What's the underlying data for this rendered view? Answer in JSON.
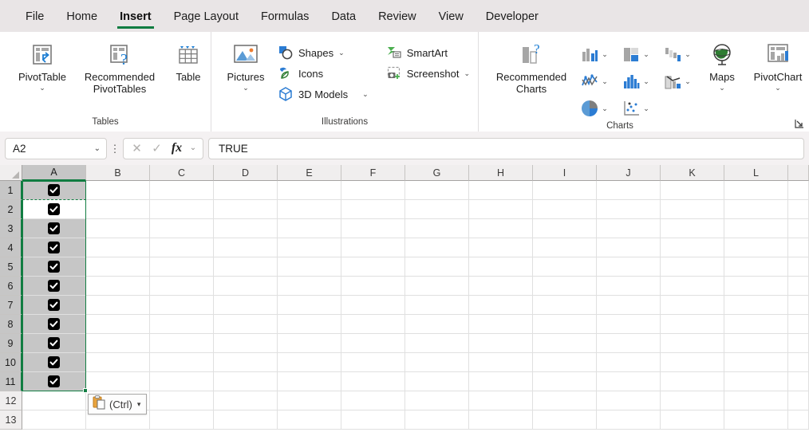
{
  "tabs": [
    {
      "label": "File",
      "active": false
    },
    {
      "label": "Home",
      "active": false
    },
    {
      "label": "Insert",
      "active": true
    },
    {
      "label": "Page Layout",
      "active": false
    },
    {
      "label": "Formulas",
      "active": false
    },
    {
      "label": "Data",
      "active": false
    },
    {
      "label": "Review",
      "active": false
    },
    {
      "label": "View",
      "active": false
    },
    {
      "label": "Developer",
      "active": false
    }
  ],
  "ribbon": {
    "groups": {
      "tables": {
        "label": "Tables",
        "pivot_table": "PivotTable",
        "recommended_pivot_tables": "Recommended PivotTables",
        "table": "Table"
      },
      "illustrations": {
        "label": "Illustrations",
        "pictures": "Pictures",
        "shapes": "Shapes",
        "icons": "Icons",
        "models_3d": "3D Models",
        "smartart": "SmartArt",
        "screenshot": "Screenshot"
      },
      "charts": {
        "label": "Charts",
        "recommended_charts": "Recommended Charts",
        "maps": "Maps",
        "pivot_chart": "PivotChart"
      }
    }
  },
  "formula_bar": {
    "name_box_value": "A2",
    "formula_value": "TRUE",
    "cancel_label": "✕",
    "enter_label": "✓",
    "fx_label": "fx"
  },
  "grid": {
    "columns": [
      "A",
      "B",
      "C",
      "D",
      "E",
      "F",
      "G",
      "H",
      "I",
      "J",
      "K",
      "L"
    ],
    "selected_column": "A",
    "rows": [
      1,
      2,
      3,
      4,
      5,
      6,
      7,
      8,
      9,
      10,
      11,
      12,
      13
    ],
    "selected_rows": [
      1,
      2,
      3,
      4,
      5,
      6,
      7,
      8,
      9,
      10,
      11
    ],
    "active_cell": "A2",
    "copy_source_range": "A1",
    "selection_range": "A1:A11",
    "checkbox_rows": [
      1,
      2,
      3,
      4,
      5,
      6,
      7,
      8,
      9,
      10,
      11
    ],
    "checkbox_value": "TRUE"
  },
  "paste_options": {
    "label": "(Ctrl)",
    "caret": "▾"
  },
  "colors": {
    "accent_green": "#107c41",
    "selection_green": "#137e43",
    "selected_fill": "#c6c6c6",
    "header_fill": "#f0eeee",
    "ribbon_tabbar": "#e9e5e6",
    "gridline": "#e0e0e0",
    "checkbox_fill": "#000000"
  }
}
